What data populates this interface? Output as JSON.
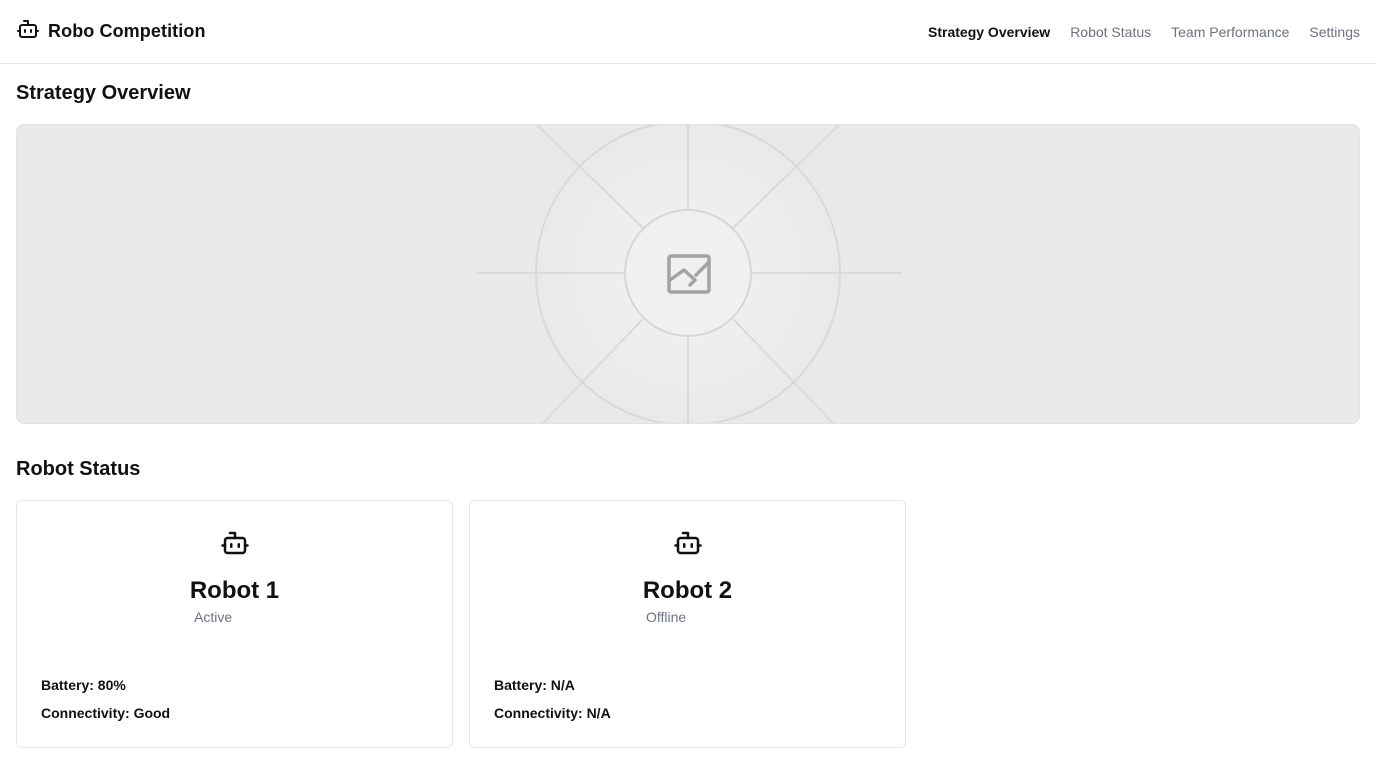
{
  "header": {
    "brand_icon": "robot-icon",
    "title": "Robo Competition",
    "nav": [
      {
        "label": "Strategy Overview",
        "active": true
      },
      {
        "label": "Robot Status",
        "active": false
      },
      {
        "label": "Team Performance",
        "active": false
      },
      {
        "label": "Settings",
        "active": false
      }
    ]
  },
  "strategy": {
    "title": "Strategy Overview",
    "image_icon": "image-placeholder-icon"
  },
  "robot_status": {
    "title": "Robot Status",
    "robots": [
      {
        "name": "Robot 1",
        "status": "Active",
        "battery": "Battery: 80%",
        "connectivity": "Connectivity: Good",
        "icon": "robot-icon"
      },
      {
        "name": "Robot 2",
        "status": "Offline",
        "battery": "Battery: N/A",
        "connectivity": "Connectivity: N/A",
        "icon": "robot-icon"
      }
    ]
  },
  "colors": {
    "text_primary": "#111111",
    "text_muted": "#6b7280",
    "border": "#e5e7eb",
    "panel_bg": "#e9e9e9"
  }
}
